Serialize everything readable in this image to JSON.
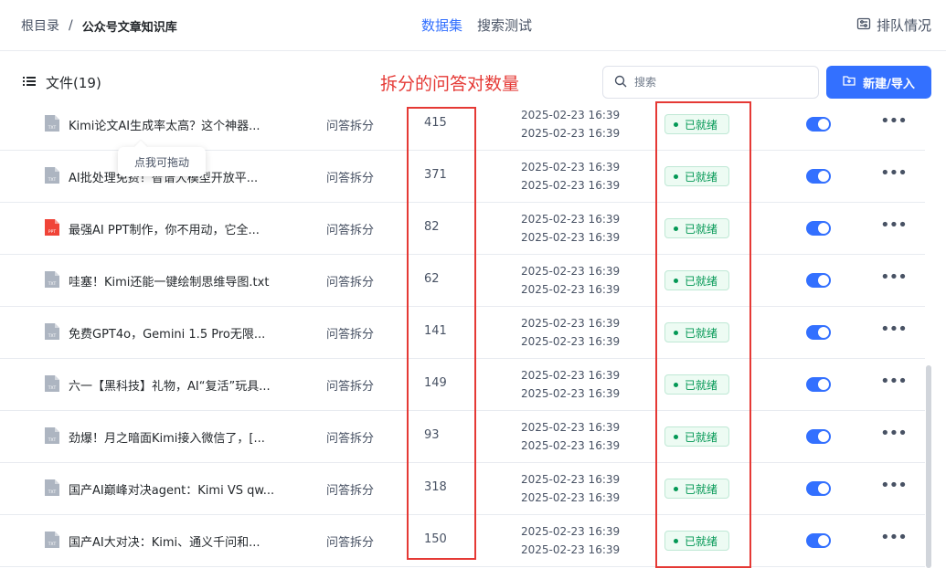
{
  "breadcrumb": {
    "root": "根目录",
    "separator": "/",
    "current": "公众号文章知识库"
  },
  "tabs": [
    {
      "label": "数据集",
      "active": true
    },
    {
      "label": "搜索测试",
      "active": false
    }
  ],
  "queue_label": "排队情况",
  "files_title": "文件(19)",
  "annotation": "拆分的问答对数量",
  "search": {
    "placeholder": "搜索"
  },
  "new_button": "新建/导入",
  "tooltip": "点我可拖动",
  "colors": {
    "accent": "#3370ff",
    "ready": "#039855",
    "highlight": "#e53935",
    "ppt": "#f04438",
    "txt": "#8a95a7"
  },
  "rows": [
    {
      "icon": "txt-file-icon",
      "name": "Kimi论文AI生成率太高？这个神器...",
      "mode": "问答拆分",
      "count": "415",
      "created": "2025-02-23 16:39",
      "updated": "2025-02-23 16:39",
      "status": "已就绪",
      "enabled": true
    },
    {
      "icon": "txt-file-icon",
      "name": "AI批处理免费！智谱大模型开放平...",
      "mode": "问答拆分",
      "count": "371",
      "created": "2025-02-23 16:39",
      "updated": "2025-02-23 16:39",
      "status": "已就绪",
      "enabled": true
    },
    {
      "icon": "ppt-file-icon",
      "name": "最强AI PPT制作，你不用动，它全...",
      "mode": "问答拆分",
      "count": "82",
      "created": "2025-02-23 16:39",
      "updated": "2025-02-23 16:39",
      "status": "已就绪",
      "enabled": true
    },
    {
      "icon": "txt-file-icon",
      "name": "哇塞！Kimi还能一键绘制思维导图.txt",
      "mode": "问答拆分",
      "count": "62",
      "created": "2025-02-23 16:39",
      "updated": "2025-02-23 16:39",
      "status": "已就绪",
      "enabled": true
    },
    {
      "icon": "txt-file-icon",
      "name": "免费GPT4o，Gemini 1.5 Pro无限...",
      "mode": "问答拆分",
      "count": "141",
      "created": "2025-02-23 16:39",
      "updated": "2025-02-23 16:39",
      "status": "已就绪",
      "enabled": true
    },
    {
      "icon": "txt-file-icon",
      "name": "六一【黑科技】礼物，AI“复活”玩具...",
      "mode": "问答拆分",
      "count": "149",
      "created": "2025-02-23 16:39",
      "updated": "2025-02-23 16:39",
      "status": "已就绪",
      "enabled": true
    },
    {
      "icon": "txt-file-icon",
      "name": "劲爆！月之暗面Kimi接入微信了，[...",
      "mode": "问答拆分",
      "count": "93",
      "created": "2025-02-23 16:39",
      "updated": "2025-02-23 16:39",
      "status": "已就绪",
      "enabled": true
    },
    {
      "icon": "txt-file-icon",
      "name": "国产AI巅峰对决agent：Kimi VS qw...",
      "mode": "问答拆分",
      "count": "318",
      "created": "2025-02-23 16:39",
      "updated": "2025-02-23 16:39",
      "status": "已就绪",
      "enabled": true
    },
    {
      "icon": "txt-file-icon",
      "name": "国产AI大对决：Kimi、通义千问和...",
      "mode": "问答拆分",
      "count": "150",
      "created": "2025-02-23 16:39",
      "updated": "2025-02-23 16:39",
      "status": "已就绪",
      "enabled": true
    }
  ]
}
